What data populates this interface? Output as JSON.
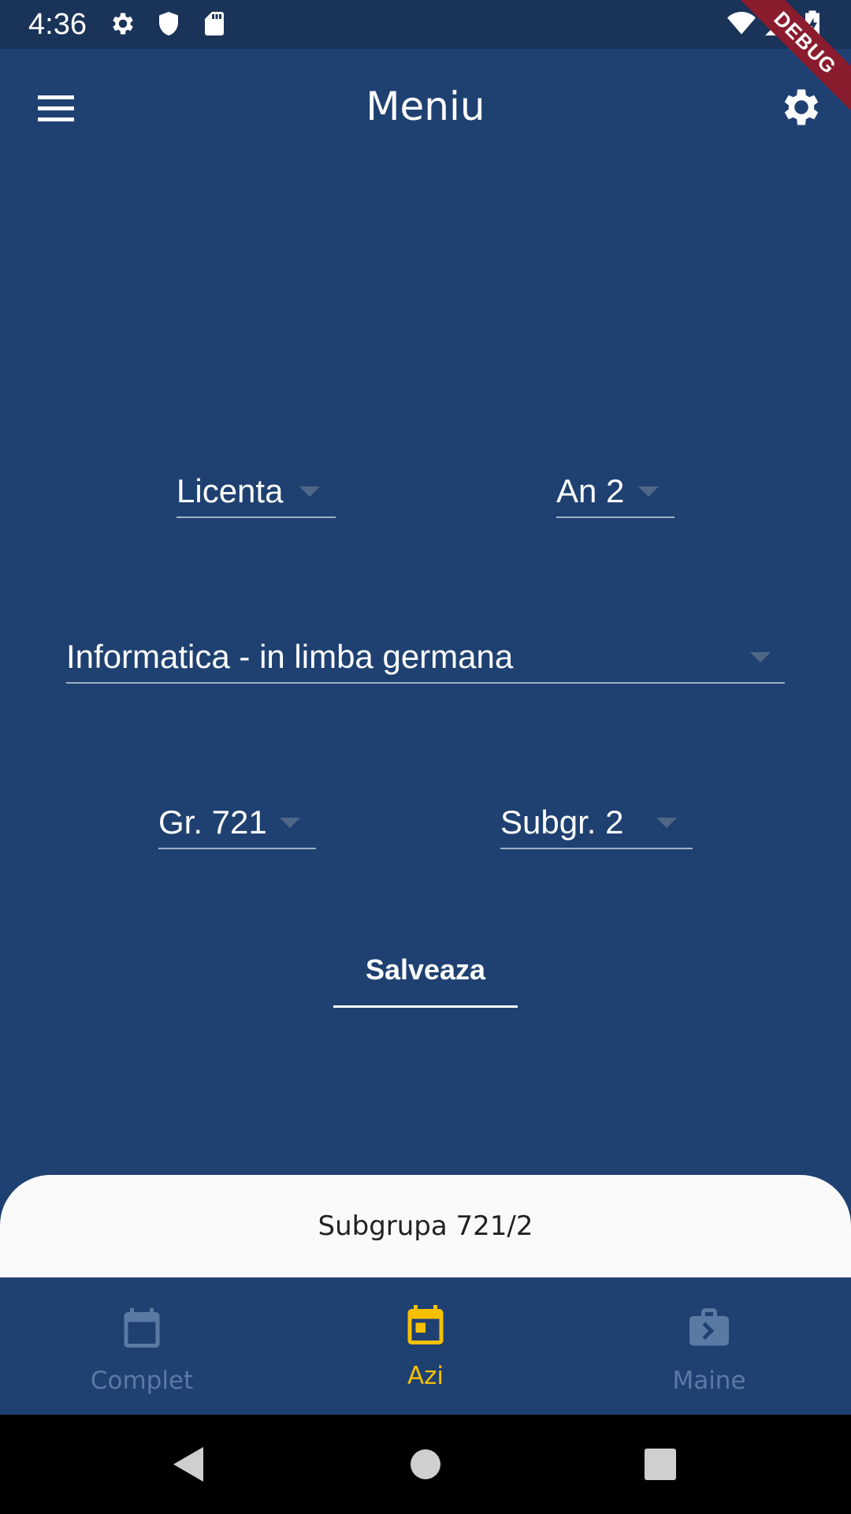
{
  "status_bar": {
    "time": "4:36",
    "icons": [
      "gear-icon",
      "shield-icon",
      "sd-card-icon",
      "wifi-icon",
      "signal-icon",
      "battery-charging-icon"
    ],
    "debug_banner": "DEBUG"
  },
  "app_bar": {
    "title": "Meniu",
    "left_icon": "hamburger-menu-icon",
    "right_icon": "settings-gear-icon"
  },
  "form": {
    "level": "Licenta",
    "year": "An 2",
    "specialization": "Informatica - in limba germana",
    "group": "Gr. 721",
    "subgroup": "Subgr. 2",
    "save_label": "Salveaza"
  },
  "bottom_sheet": {
    "text": "Subgrupa 721/2"
  },
  "bottom_nav": {
    "items": [
      {
        "label": "Complet",
        "icon": "calendar-icon",
        "active": false
      },
      {
        "label": "Azi",
        "icon": "calendar-today-icon",
        "active": true
      },
      {
        "label": "Maine",
        "icon": "briefcase-next-icon",
        "active": false
      }
    ]
  },
  "system_nav": {
    "buttons": [
      "back-icon",
      "home-icon",
      "recents-icon"
    ]
  },
  "colors": {
    "background": "#1f4171",
    "status_bar": "#1a3358",
    "accent": "#f6c000",
    "inactive_nav": "#5a7aa3",
    "debug_banner": "#8a1c2e",
    "sheet": "#fafafa"
  }
}
